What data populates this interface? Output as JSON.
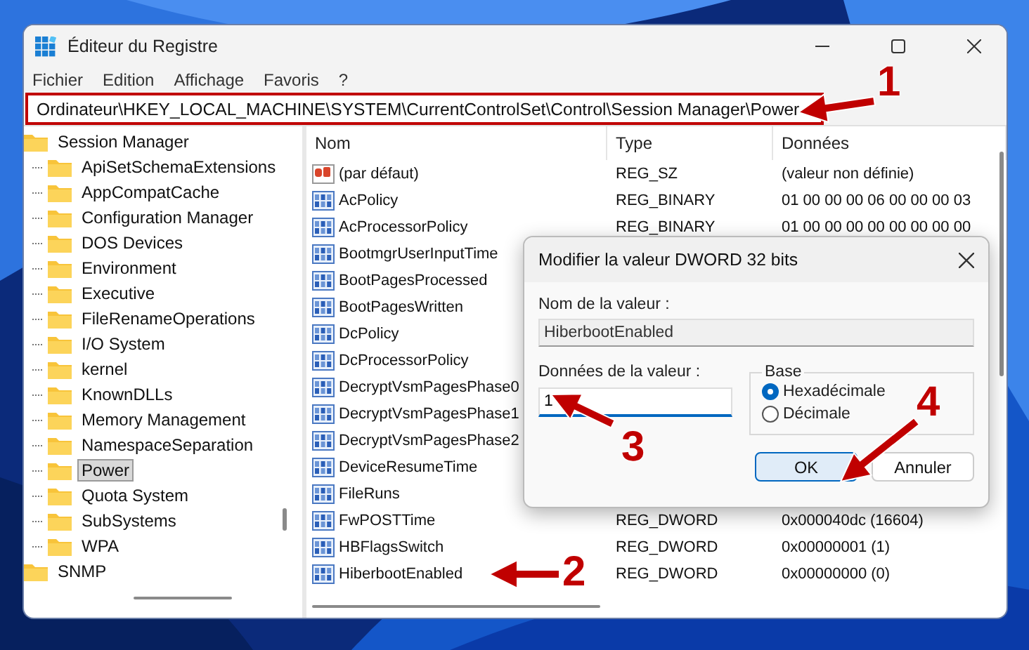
{
  "window": {
    "title": "Éditeur du Registre"
  },
  "menu": [
    "Fichier",
    "Edition",
    "Affichage",
    "Favoris",
    "?"
  ],
  "address_bar": {
    "value": "Ordinateur\\HKEY_LOCAL_MACHINE\\SYSTEM\\CurrentControlSet\\Control\\Session Manager\\Power",
    "highlighted": true
  },
  "tree": {
    "items": [
      {
        "label": "Session Manager",
        "selected": false,
        "children": [
          {
            "label": "ApiSetSchemaExtensions",
            "selected": false
          },
          {
            "label": "AppCompatCache",
            "selected": false
          },
          {
            "label": "Configuration Manager",
            "selected": false
          },
          {
            "label": "DOS Devices",
            "selected": false
          },
          {
            "label": "Environment",
            "selected": false
          },
          {
            "label": "Executive",
            "selected": false
          },
          {
            "label": "FileRenameOperations",
            "selected": false
          },
          {
            "label": "I/O System",
            "selected": false
          },
          {
            "label": "kernel",
            "selected": false
          },
          {
            "label": "KnownDLLs",
            "selected": false
          },
          {
            "label": "Memory Management",
            "selected": false
          },
          {
            "label": "NamespaceSeparation",
            "selected": false
          },
          {
            "label": "Power",
            "selected": true
          },
          {
            "label": "Quota System",
            "selected": false
          },
          {
            "label": "SubSystems",
            "selected": false
          },
          {
            "label": "WPA",
            "selected": false
          }
        ]
      },
      {
        "label": "SNMP",
        "selected": false
      }
    ]
  },
  "list": {
    "columns": [
      "Nom",
      "Type",
      "Données"
    ],
    "rows": [
      {
        "kind": "string",
        "name": "(par défaut)",
        "type": "REG_SZ",
        "data": "(valeur non définie)"
      },
      {
        "kind": "binary",
        "name": "AcPolicy",
        "type": "REG_BINARY",
        "data": "01 00 00 00 06 00 00 00 03"
      },
      {
        "kind": "binary",
        "name": "AcProcessorPolicy",
        "type": "REG_BINARY",
        "data": "01 00 00 00 00 00 00 00 00"
      },
      {
        "kind": "binary",
        "name": "BootmgrUserInputTime"
      },
      {
        "kind": "binary",
        "name": "BootPagesProcessed"
      },
      {
        "kind": "binary",
        "name": "BootPagesWritten"
      },
      {
        "kind": "binary",
        "name": "DcPolicy"
      },
      {
        "kind": "binary",
        "name": "DcProcessorPolicy"
      },
      {
        "kind": "binary",
        "name": "DecryptVsmPagesPhase0"
      },
      {
        "kind": "binary",
        "name": "DecryptVsmPagesPhase1"
      },
      {
        "kind": "binary",
        "name": "DecryptVsmPagesPhase2"
      },
      {
        "kind": "binary",
        "name": "DeviceResumeTime"
      },
      {
        "kind": "binary",
        "name": "FileRuns"
      },
      {
        "kind": "binary",
        "name": "FwPOSTTime",
        "type": "REG_DWORD",
        "data": "0x000040dc (16604)"
      },
      {
        "kind": "binary",
        "name": "HBFlagsSwitch",
        "type": "REG_DWORD",
        "data": "0x00000001 (1)"
      },
      {
        "kind": "binary",
        "name": "HiberbootEnabled",
        "type": "REG_DWORD",
        "data": "0x00000000 (0)"
      }
    ]
  },
  "dialog": {
    "title": "Modifier la valeur DWORD 32 bits",
    "name_label": "Nom de la valeur :",
    "name_value": "HiberbootEnabled",
    "data_label": "Données de la valeur :",
    "data_value": "1",
    "base": {
      "label": "Base",
      "options": [
        {
          "label": "Hexadécimale",
          "selected": true
        },
        {
          "label": "Décimale",
          "selected": false
        }
      ]
    },
    "buttons": [
      {
        "label": "OK",
        "default": true
      },
      {
        "label": "Annuler",
        "default": false
      }
    ]
  },
  "annotations": [
    {
      "number": "1"
    },
    {
      "number": "2"
    },
    {
      "number": "3"
    },
    {
      "number": "4"
    }
  ]
}
